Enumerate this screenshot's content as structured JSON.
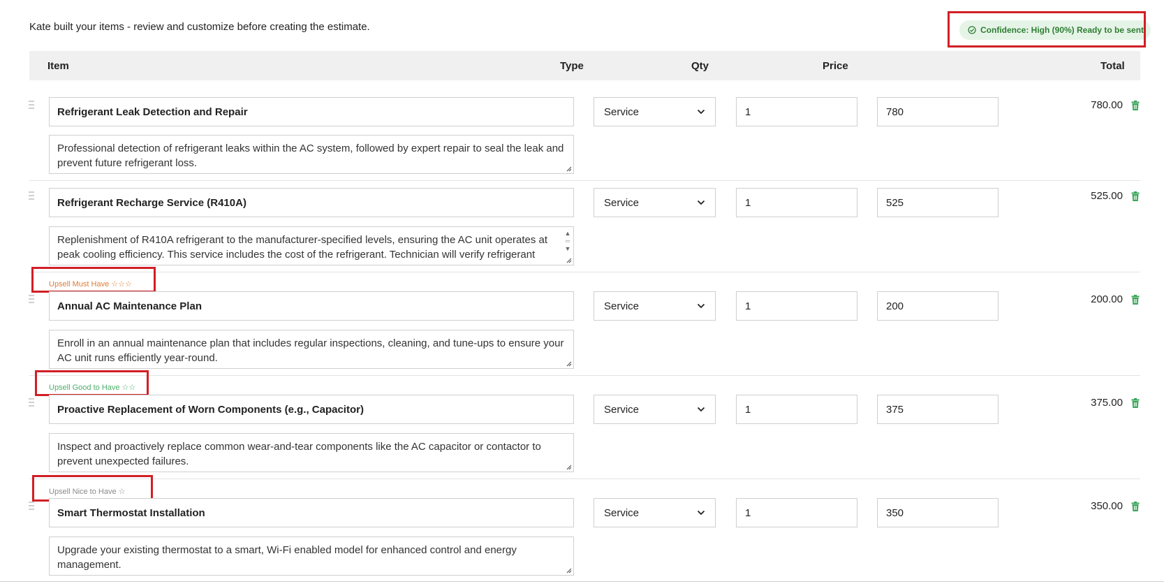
{
  "intro_text": "Kate built your items - review and customize before creating the estimate.",
  "confidence": {
    "label": "Confidence: High (90%) Ready to be sent",
    "color": "#2e7d32",
    "background": "#e6f4e8"
  },
  "columns": {
    "item": "Item",
    "type": "Type",
    "qty": "Qty",
    "price": "Price",
    "total": "Total"
  },
  "items": [
    {
      "upsell": "",
      "name": "Refrigerant Leak Detection and Repair",
      "description": "Professional detection of refrigerant leaks within the AC system, followed by expert repair to seal the leak and prevent future refrigerant loss.",
      "type": "Service",
      "qty": "1",
      "price": "780",
      "total": "780.00"
    },
    {
      "upsell": "",
      "name": "Refrigerant Recharge Service (R410A)",
      "description": "Replenishment of R410A refrigerant to the manufacturer-specified levels, ensuring the AC unit operates at peak cooling efficiency. This service includes the cost of the refrigerant. Technician will verify refrigerant",
      "type": "Service",
      "qty": "1",
      "price": "525",
      "total": "525.00"
    },
    {
      "upsell": "Upsell Must Have ☆☆☆",
      "upsell_color": "#e07b39",
      "name": "Annual AC Maintenance Plan",
      "description": "Enroll in an annual maintenance plan that includes regular inspections, cleaning, and tune-ups to ensure your AC unit runs efficiently year-round.",
      "type": "Service",
      "qty": "1",
      "price": "200",
      "total": "200.00"
    },
    {
      "upsell": "Upsell Good to Have ☆☆",
      "upsell_color": "#4caf6a",
      "name": "Proactive Replacement of Worn Components (e.g., Capacitor)",
      "description": "Inspect and proactively replace common wear-and-tear components like the AC capacitor or contactor to prevent unexpected failures.",
      "type": "Service",
      "qty": "1",
      "price": "375",
      "total": "375.00"
    },
    {
      "upsell": "Upsell Nice to Have ☆",
      "upsell_color": "#8a8a8a",
      "name": "Smart Thermostat Installation",
      "description": "Upgrade your existing thermostat to a smart, Wi-Fi enabled model for enhanced control and energy management.",
      "type": "Service",
      "qty": "1",
      "price": "350",
      "total": "350.00"
    }
  ],
  "icons": {
    "confidence": "check-circle-icon",
    "delete": "trash-icon",
    "drag": "drag-handle-icon",
    "dropdown": "chevron-down-icon"
  },
  "colors": {
    "trash": "#3aa55a",
    "highlight_box": "#d11f26"
  }
}
